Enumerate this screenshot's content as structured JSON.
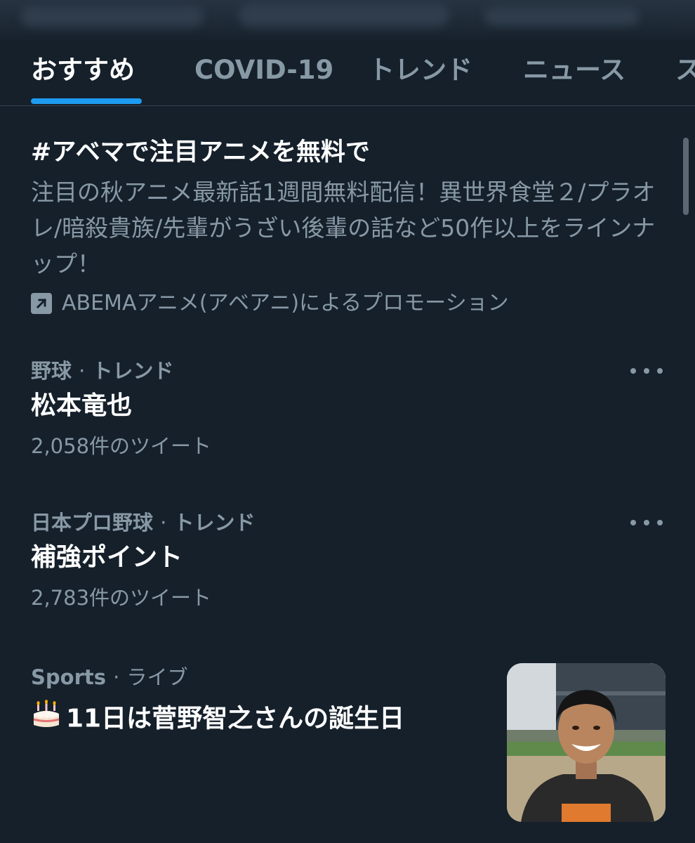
{
  "tabs": [
    {
      "label": "おすすめ",
      "active": true
    },
    {
      "label": "COVID-19",
      "active": false
    },
    {
      "label": "トレンド",
      "active": false
    },
    {
      "label": "ニュース",
      "active": false
    },
    {
      "label": "ス",
      "active": false
    }
  ],
  "promo": {
    "title": "#アベマで注目アニメを無料で",
    "description": "注目の秋アニメ最新話1週間無料配信！異世界食堂２/プラオレ/暗殺貴族/先輩がうざい後輩の話など50作以上をラインナップ！",
    "promoted_by": "ABEMAアニメ(アベアニ)によるプロモーション",
    "icon": "promoted-arrow-icon"
  },
  "trends": [
    {
      "category": "野球",
      "separator": "·",
      "context": "トレンド",
      "name": "松本竜也",
      "tweet_count": "2,058件のツイート"
    },
    {
      "category": "日本プロ野球",
      "separator": "·",
      "context": "トレンド",
      "name": "補強ポイント",
      "tweet_count": "2,783件のツイート"
    }
  ],
  "live_event": {
    "category": "Sports",
    "separator": "·",
    "context": "ライブ",
    "emoji": "🎂",
    "title": "11日は菅野智之さんの誕生日",
    "thumbnail_alt": "player-photo"
  },
  "colors": {
    "background": "#15202b",
    "accent": "#1d9bf0",
    "secondary_text": "#8899a6",
    "primary_text": "#ffffff"
  }
}
